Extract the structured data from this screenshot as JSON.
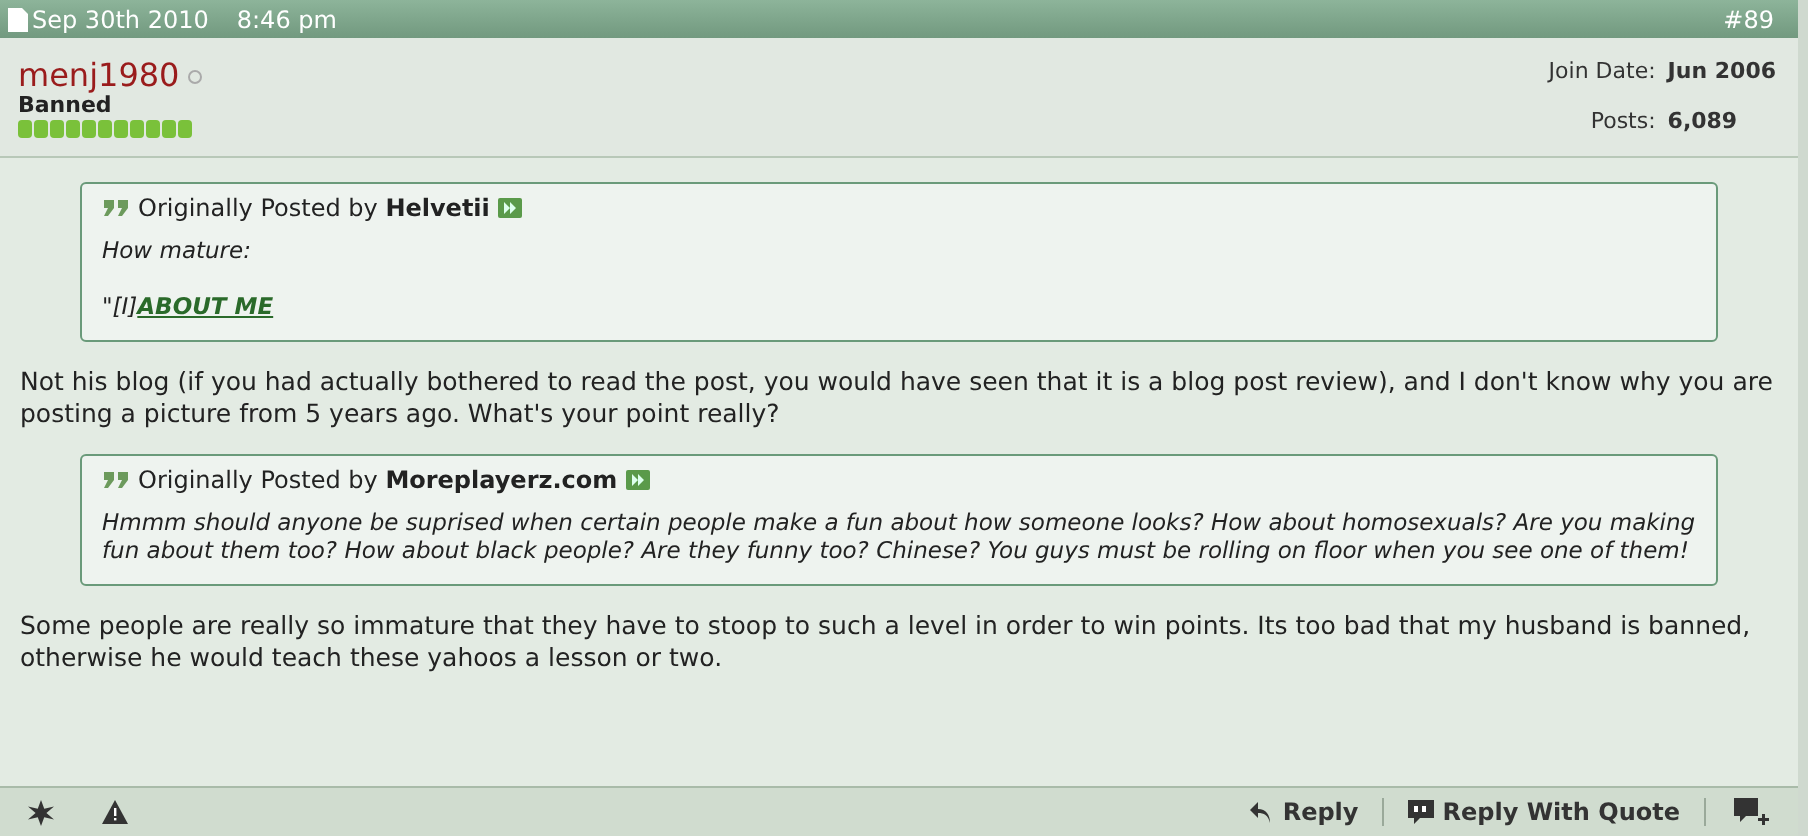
{
  "post_header": {
    "date": "Sep 30th 2010",
    "time": "8:46 pm",
    "post_number": "#89"
  },
  "user": {
    "name": "menj1980",
    "online": false,
    "title": "Banned",
    "join_date_label": "Join Date:",
    "join_date": "Jun 2006",
    "posts_label": "Posts:",
    "posts": "6,089"
  },
  "content": [
    {
      "kind": "quote",
      "prefix": "Originally Posted by",
      "author": "Helvetii",
      "lines": [
        "How mature:",
        "\"[I]"
      ],
      "link": "ABOUT ME"
    },
    {
      "kind": "text",
      "text": "Not his blog (if you had actually bothered to read the post, you would have seen that it is a blog post review), and I don't know why you are posting a picture from 5 years ago. What's your point really?"
    },
    {
      "kind": "quote",
      "prefix": "Originally Posted by",
      "author": "Moreplayerz.com",
      "lines": [
        "Hmmm should anyone be suprised when certain people make a fun about how someone looks? How about homosexuals? Are you making fun about them too? How about black people? Are they funny too? Chinese? You guys must be rolling on floor when you see one of them!"
      ]
    },
    {
      "kind": "text",
      "text": "Some people are really so immature that they have to stoop to such a level in order to win points. Its too bad that my husband is banned, otherwise he would teach these yahoos a lesson or two."
    }
  ],
  "footer": {
    "reply": "Reply",
    "reply_with_quote": "Reply With Quote"
  }
}
